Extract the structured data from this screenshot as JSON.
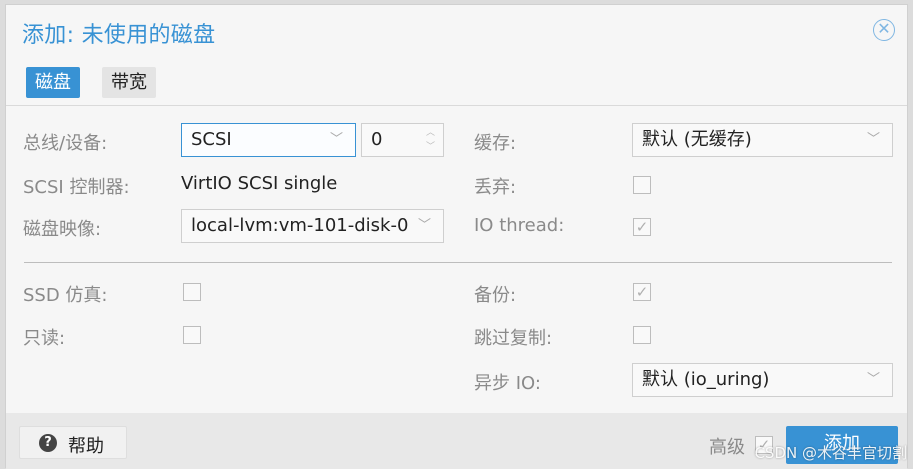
{
  "dialog": {
    "title": "添加: 未使用的磁盘",
    "close_icon": "close-circle-icon"
  },
  "tabs": [
    {
      "label": "磁盘",
      "active": true
    },
    {
      "label": "带宽",
      "active": false
    }
  ],
  "form": {
    "bus_device": {
      "label": "总线/设备:",
      "bus_value": "SCSI",
      "device_number": "0"
    },
    "scsi_controller": {
      "label": "SCSI 控制器:",
      "value": "VirtIO SCSI single"
    },
    "disk_image": {
      "label": "磁盘映像:",
      "value": "local-lvm:vm-101-disk-0"
    },
    "cache": {
      "label": "缓存:",
      "value": "默认 (无缓存)"
    },
    "discard": {
      "label": "丢弃:",
      "checked": false
    },
    "io_thread": {
      "label": "IO thread:",
      "checked": true
    },
    "ssd_emulation": {
      "label": "SSD 仿真:",
      "checked": false
    },
    "read_only": {
      "label": "只读:",
      "checked": false
    },
    "backup": {
      "label": "备份:",
      "checked": true
    },
    "skip_replication": {
      "label": "跳过复制:",
      "checked": false
    },
    "async_io": {
      "label": "异步 IO:",
      "value": "默认 (io_uring)"
    }
  },
  "footer": {
    "help_label": "帮助",
    "advanced_label": "高级",
    "advanced_checked": true,
    "add_label": "添加"
  },
  "watermark": "CSDN @木谷丰官切割",
  "colors": {
    "accent": "#3892d4",
    "label": "#8a8a8a"
  }
}
